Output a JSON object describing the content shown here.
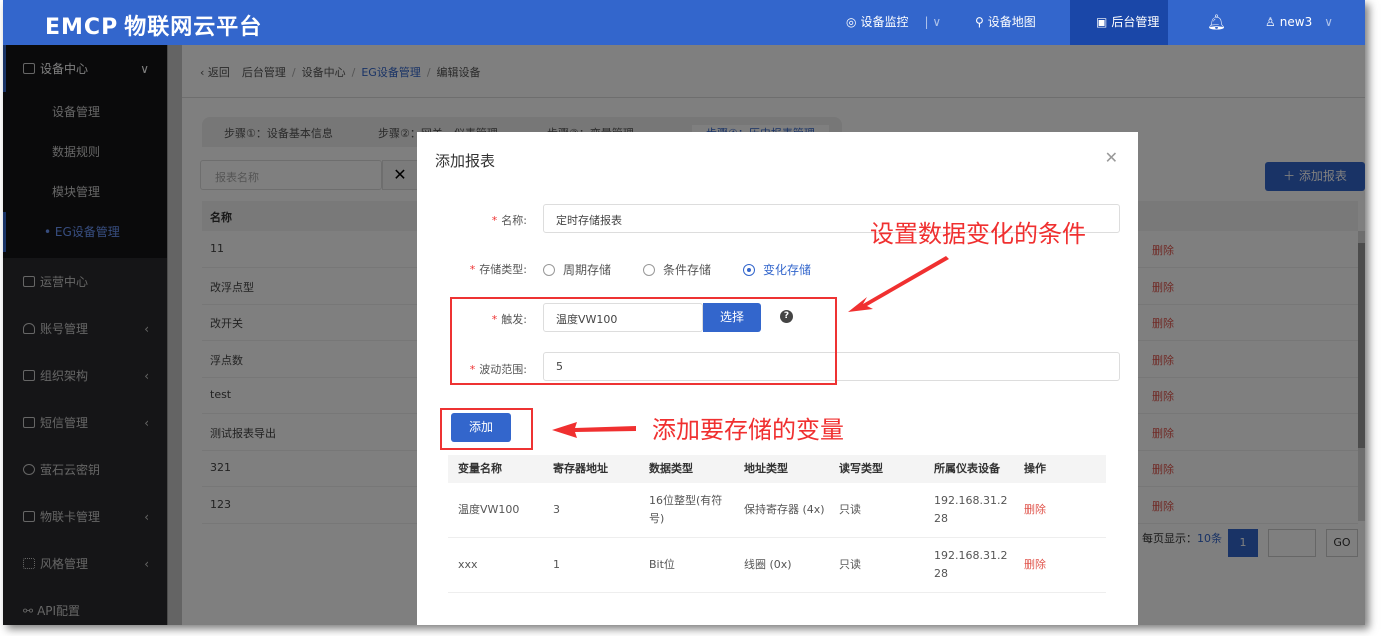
{
  "header": {
    "logo": "EMCP",
    "logo_cn": "物联网云平台",
    "nav": [
      {
        "label": "设备监控"
      },
      {
        "label": "设备地图"
      },
      {
        "label": "后台管理"
      }
    ],
    "user": "new3",
    "accent": "#3366cc"
  },
  "sidebar": {
    "group": "设备中心",
    "subitems": [
      "设备管理",
      "数据规则",
      "模块管理",
      "• EG设备管理"
    ],
    "items": [
      "运营中心",
      "账号管理",
      "组织架构",
      "短信管理",
      "萤石云密钥",
      "物联卡管理",
      "风格管理",
      "API配置"
    ]
  },
  "breadcrumb": {
    "back": "返回",
    "items": [
      "后台管理",
      "设备中心",
      "EG设备管理",
      "编辑设备"
    ]
  },
  "steps": [
    "步骤①：设备基本信息",
    "步骤②：网关、仪表管理",
    "步骤③：变量管理",
    "步骤④：历史报表管理"
  ],
  "list": {
    "search_placeholder": "报表名称",
    "add_label": "添加报表",
    "col_name": "名称",
    "rows": [
      "11",
      "改浮点型",
      "改开关",
      "浮点数",
      "test",
      "测试报表导出",
      "321",
      "123"
    ],
    "delete": "删除",
    "page_size_label": "每页显示：",
    "page_size": "10条",
    "page": "1",
    "go": "GO"
  },
  "modal": {
    "title": "添加报表",
    "name_label": "名称:",
    "name_value": "定时存储报表",
    "type_label": "存储类型:",
    "types": [
      "周期存储",
      "条件存储",
      "变化存储"
    ],
    "selected_type": "变化存储",
    "trigger_label": "触发:",
    "trigger_value": "温度VW100",
    "choose": "选择",
    "range_label": "波动范围:",
    "range_value": "5",
    "add": "添加",
    "columns": [
      "变量名称",
      "寄存器地址",
      "数据类型",
      "地址类型",
      "读写类型",
      "所属仪表设备",
      "操作"
    ],
    "rows": [
      [
        "温度VW100",
        "3",
        "16位整型(有符号)",
        "保持寄存器 (4x)",
        "只读",
        "192.168.31.228",
        "删除"
      ],
      [
        "xxx",
        "1",
        "Bit位",
        "线圈 (0x)",
        "只读",
        "192.168.31.228",
        "删除"
      ]
    ]
  },
  "annotations": {
    "condition": "设置数据变化的条件",
    "add_var": "添加要存储的变量"
  }
}
